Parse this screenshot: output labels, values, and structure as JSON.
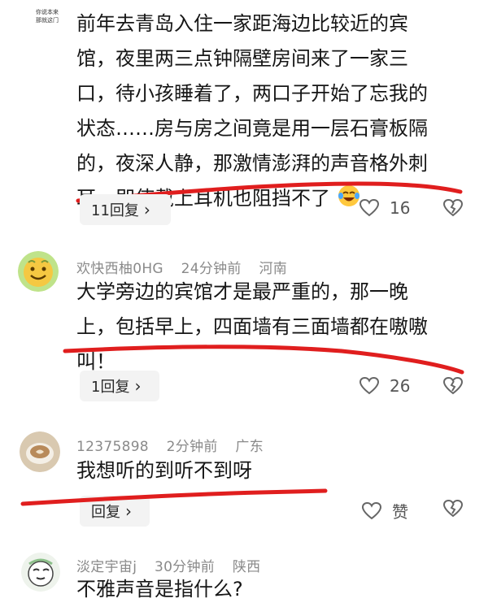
{
  "watermark": {
    "line1": "你说本来",
    "line2": "那就这门"
  },
  "comments": [
    {
      "text_lines": [
        "前年去青岛入住一家距海边比较近的宾",
        "馆，夜里两三点钟隔壁房间来了一家三",
        "口，待小孩睡着了，两口子开始了忘我的",
        "状态……房与房之间竟是用一层石膏板隔",
        "的，夜深人静，那激情澎湃的声音格外刺",
        "耳，即使戴上耳机也阻挡不了"
      ],
      "emoji": "laughing-crying-emoji",
      "reply_label": "11回复",
      "likes": "16"
    },
    {
      "username": "欢快西柚0HG",
      "time": "24分钟前",
      "location": "河南",
      "text_lines": [
        "大学旁边的宾馆才是最严重的，那一晚",
        "上，包括早上，四面墙有三面墙都在嗷嗷",
        "叫！"
      ],
      "reply_label": "1回复",
      "likes": "26"
    },
    {
      "username": "12375898",
      "time": "2分钟前",
      "location": "广东",
      "text_lines": [
        "我想听的到听不到呀"
      ],
      "reply_label": "回复",
      "likes": "赞"
    },
    {
      "username": "淡定宇宙j",
      "time": "30分钟前",
      "location": "陕西",
      "text_lines": [
        "不雅声音是指什么?"
      ]
    }
  ],
  "colors": {
    "scribble": "#e01e1e",
    "meta": "#8a8a8a",
    "pill": "#f3f3f3"
  },
  "chevron": "›"
}
